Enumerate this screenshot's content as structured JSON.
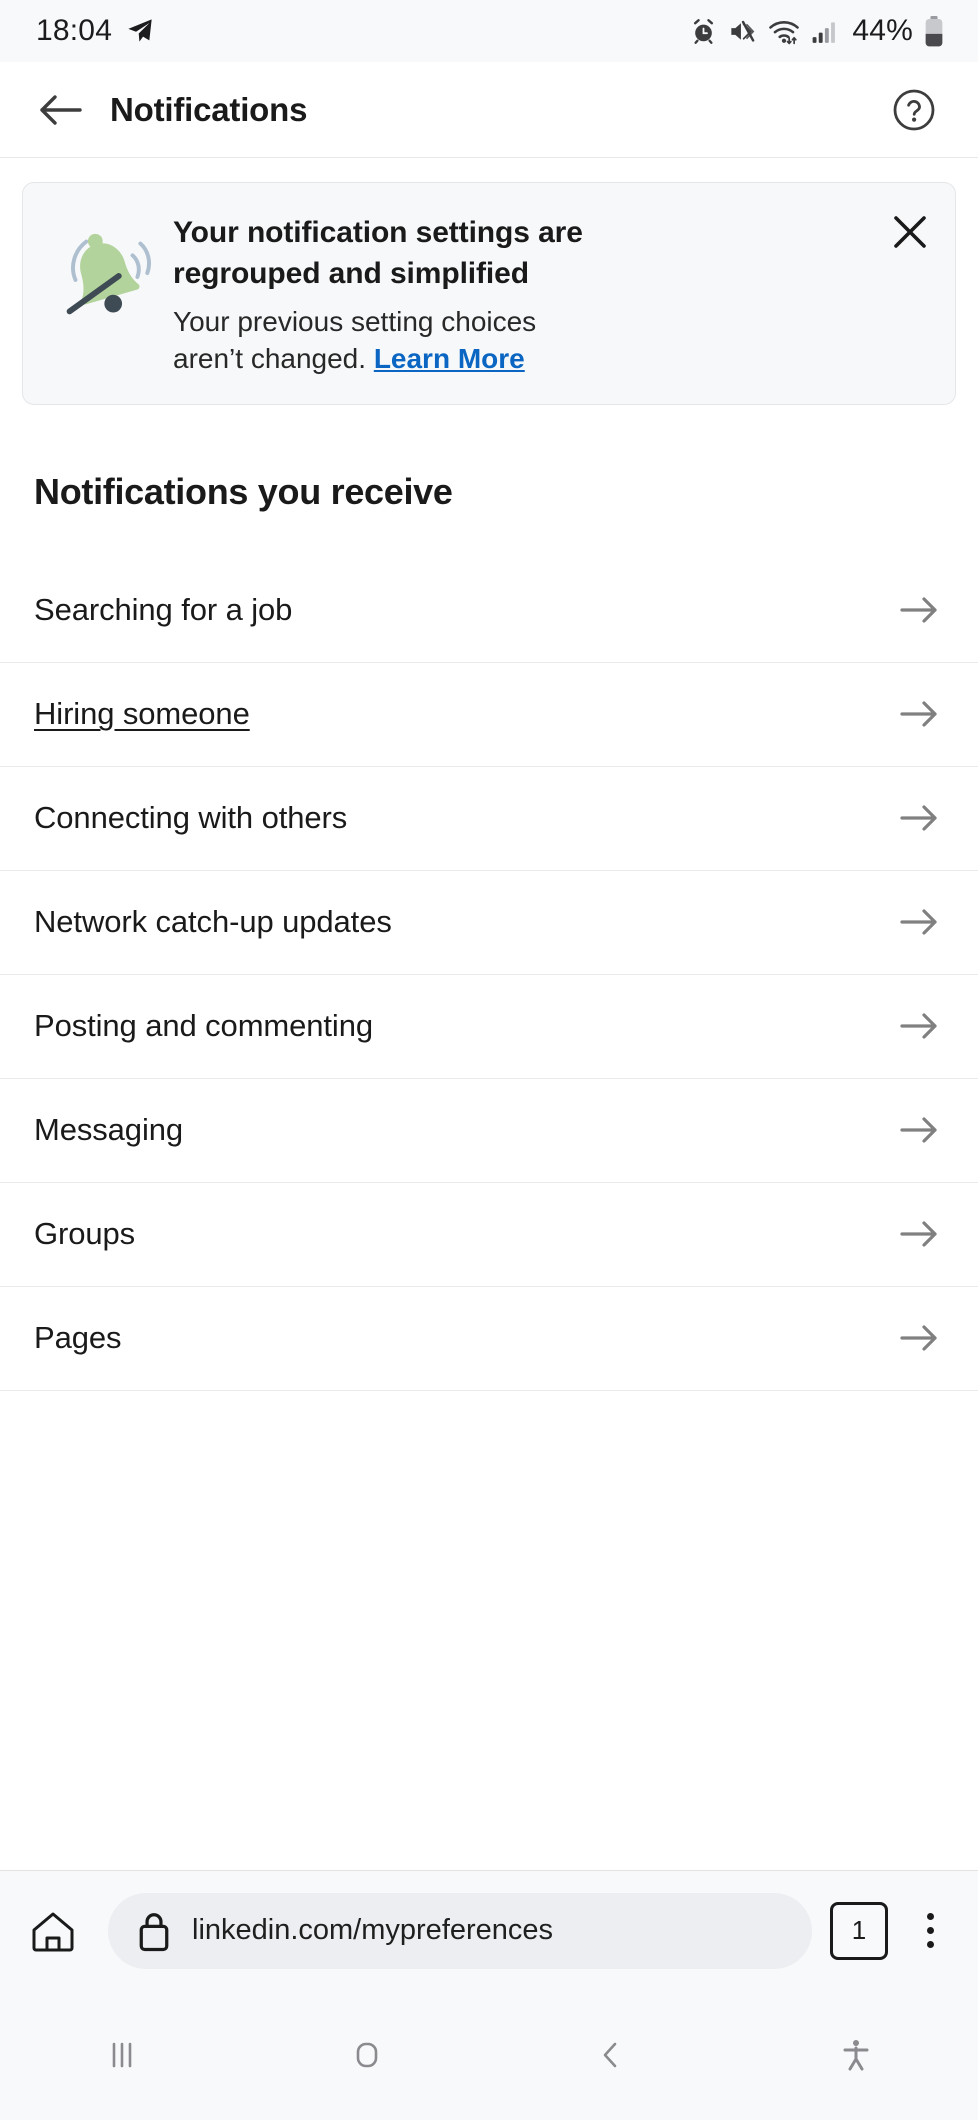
{
  "status_bar": {
    "time": "18:04",
    "battery_percent": "44%",
    "icons": [
      "telegram-send-icon",
      "alarm-icon",
      "mute-vibrate-icon",
      "wifi-icon",
      "cellular-signal-icon",
      "battery-icon"
    ]
  },
  "app_bar": {
    "title": "Notifications",
    "back_icon": "back-arrow-icon",
    "help_icon": "help-circle-icon"
  },
  "info_card": {
    "title": "Your notification settings are regrouped and simplified",
    "subtitle": "Your previous setting choices aren’t changed. ",
    "link_label": "Learn More",
    "illustration": "bell-illustration",
    "close_icon": "close-icon",
    "link_color": "#0a66c2",
    "bell_color": "#b3d39c",
    "wave_color": "#aebfd0"
  },
  "section": {
    "heading": "Notifications you receive"
  },
  "list": {
    "items": [
      {
        "label": "Searching for a job",
        "underlined": false
      },
      {
        "label": "Hiring someone",
        "underlined": true
      },
      {
        "label": "Connecting with others",
        "underlined": false
      },
      {
        "label": "Network catch-up updates",
        "underlined": false
      },
      {
        "label": "Posting and commenting",
        "underlined": false
      },
      {
        "label": "Messaging",
        "underlined": false
      },
      {
        "label": "Groups",
        "underlined": false
      },
      {
        "label": "Pages",
        "underlined": false
      }
    ],
    "arrow_icon": "arrow-right-icon"
  },
  "browser_bar": {
    "home_icon": "home-icon",
    "lock_icon": "lock-icon",
    "url": "linkedin.com/mypreferences",
    "tab_count": "1",
    "menu_icon": "overflow-menu-icon"
  },
  "nav_bar": {
    "recents_icon": "recents-icon",
    "home_icon": "home-square-icon",
    "back_icon": "back-chevron-icon",
    "accessibility_icon": "accessibility-icon"
  }
}
